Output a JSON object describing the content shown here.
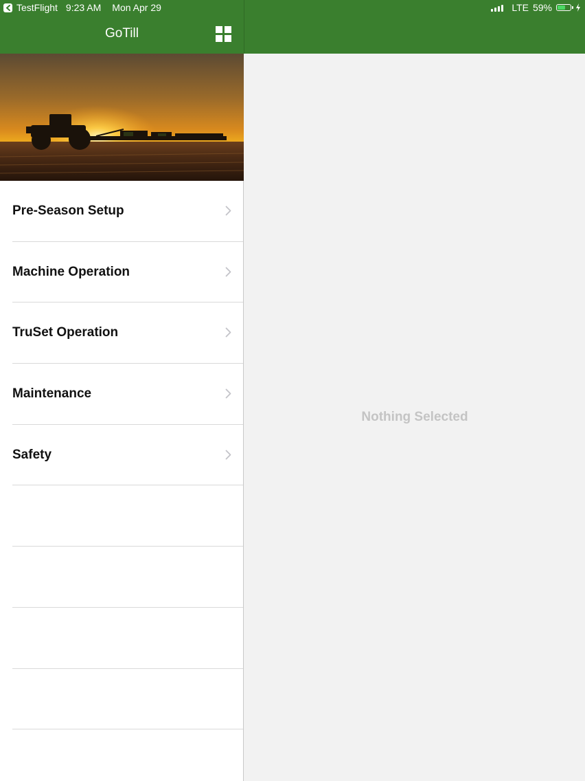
{
  "status_bar": {
    "back_app": "TestFlight",
    "time": "9:23 AM",
    "date": "Mon Apr 29",
    "network": "LTE",
    "battery": "59%",
    "battery_level": 0.59,
    "signal_bars": 4
  },
  "nav": {
    "title": "GoTill",
    "grid_icon": "grid-icon"
  },
  "hero": {
    "icon": "tractor-sunset-image"
  },
  "menu": {
    "items": [
      {
        "label": "Pre-Season Setup"
      },
      {
        "label": "Machine Operation"
      },
      {
        "label": "TruSet Operation"
      },
      {
        "label": "Maintenance"
      },
      {
        "label": "Safety"
      }
    ],
    "empty_rows": 5
  },
  "detail": {
    "placeholder": "Nothing Selected"
  },
  "colors": {
    "accent": "#3a7f2e",
    "placeholder_text": "#c4c4c4",
    "battery_fill": "#4cd964"
  }
}
